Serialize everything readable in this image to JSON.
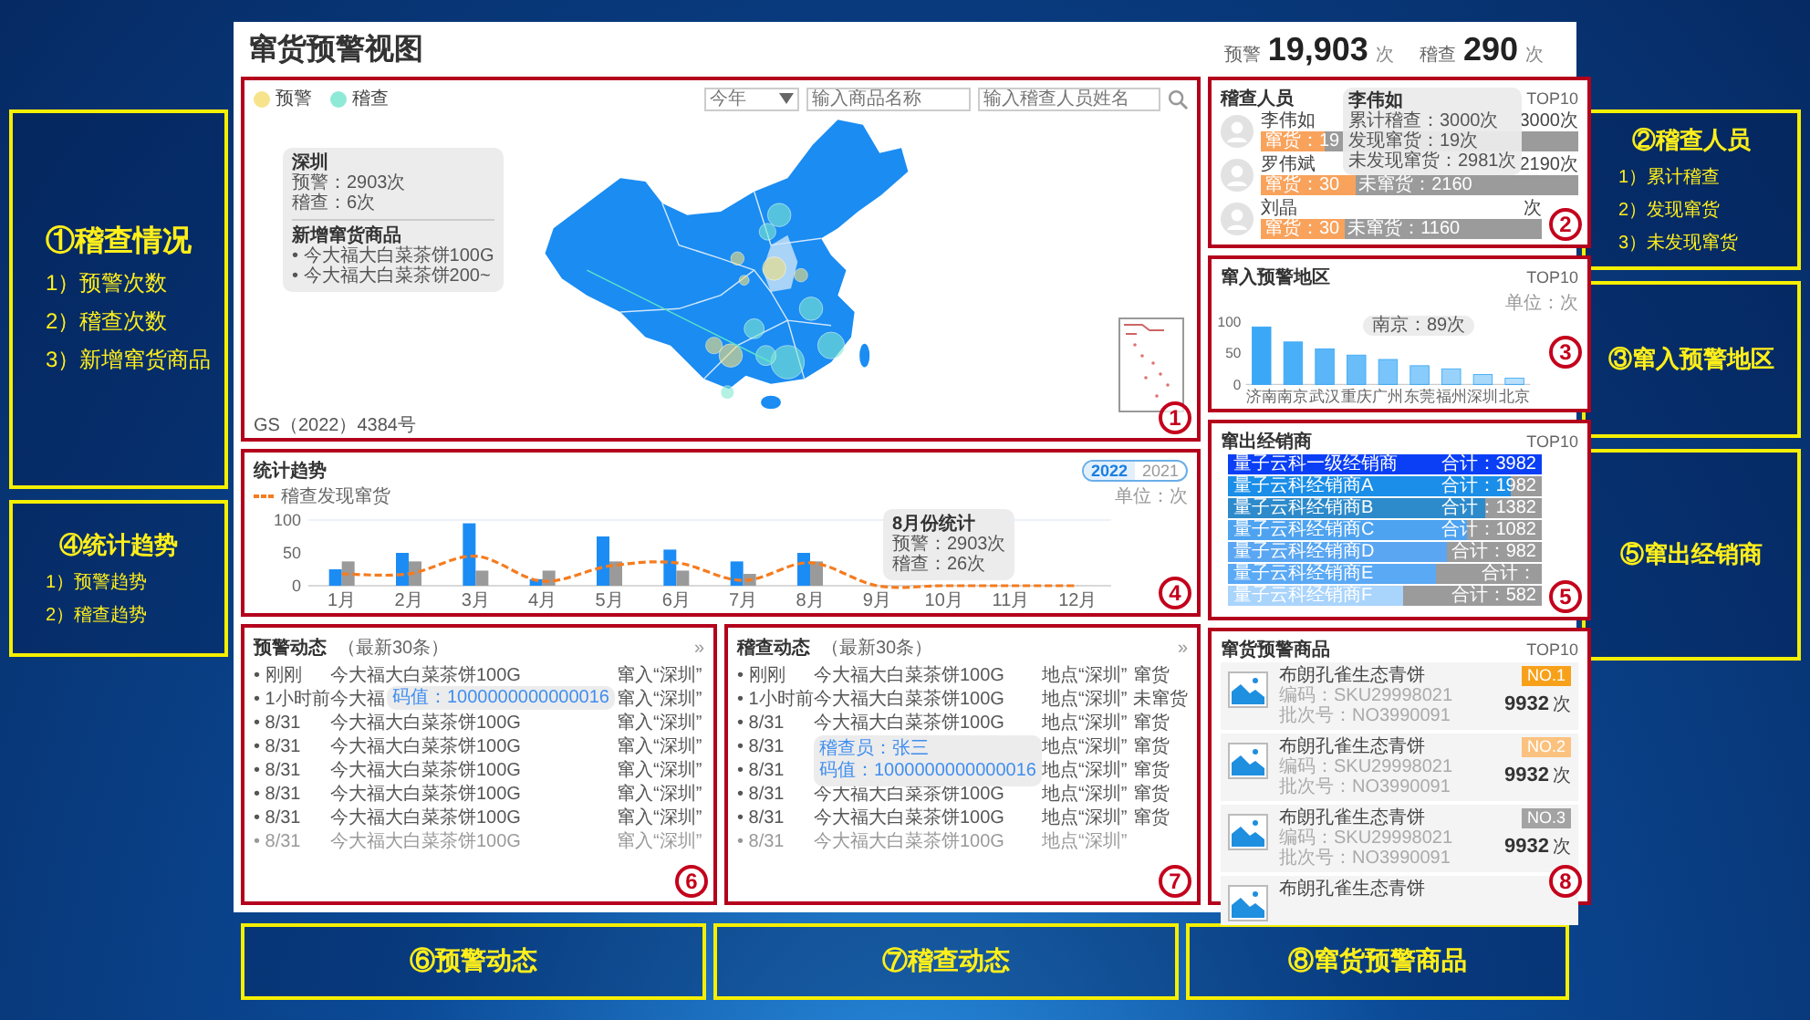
{
  "notes_left": [
    {
      "title": "①稽查情况",
      "items": [
        "1）预警次数",
        "2）稽查次数",
        "3）新增窜货商品"
      ]
    },
    {
      "title": "④统计趋势",
      "items": [
        "1）预警趋势",
        "2）稽查趋势"
      ]
    }
  ],
  "dashboard": {
    "title": "窜货预警视图",
    "totals": [
      {
        "label": "预警",
        "value": "19,903",
        "unit": "次"
      },
      {
        "label": "稽查",
        "value": "290",
        "unit": "次"
      }
    ],
    "map_panel": {
      "marker": "1",
      "legend": [
        {
          "label": "预警",
          "color": "#f6e38c"
        },
        {
          "label": "稽查",
          "color": "#8eead6"
        }
      ],
      "period": "今年",
      "search_fields": [
        {
          "placeholder": "输入商品名称"
        },
        {
          "placeholder": "输入稽查人员姓名"
        }
      ],
      "tooltip": {
        "city": "深圳",
        "lines": [
          "预警：2903次",
          "稽查：6次"
        ],
        "section": "新增窜货商品",
        "items": [
          "• 今大福大白菜茶饼100G",
          "• 今大福大白菜茶饼200~"
        ]
      },
      "footnote": "GS（2022）4384号"
    },
    "trend_panel": {
      "marker": "4",
      "title": "统计趋势",
      "years": [
        {
          "label": "2022",
          "selected": true
        },
        {
          "label": "2021",
          "selected": false
        }
      ],
      "unit": "单位：次",
      "tooltip": {
        "title": "8月份统计",
        "lines": [
          "预警：2903次",
          "稽查：26次"
        ]
      },
      "chart_data": {
        "type": "bar",
        "categories": [
          "1月",
          "2月",
          "3月",
          "4月",
          "5月",
          "6月",
          "7月",
          "8月",
          "9月",
          "10月",
          "11月",
          "12月"
        ],
        "series": [
          {
            "type": "bar",
            "color": "#1c8cf5",
            "values": [
              25,
              50,
              95,
              10,
              75,
              55,
              37,
              50,
              null,
              null,
              null,
              null
            ]
          },
          {
            "type": "bar",
            "color": "#9a9a9a",
            "values": [
              37,
              37,
              23,
              23,
              37,
              23,
              18,
              37,
              null,
              null,
              null,
              null
            ]
          },
          {
            "name": "稽查发现窜货",
            "type": "line",
            "line_style": "dashed",
            "color": "#f57c1f",
            "values": [
              18,
              18,
              45,
              7,
              30,
              35,
              8,
              35,
              0,
              0,
              0,
              0
            ]
          }
        ],
        "ylim": [
          0,
          100
        ],
        "yticks": [
          0,
          50,
          100
        ]
      }
    },
    "warning_feed": {
      "marker": "6",
      "title": "预警动态",
      "subtitle": "（最新30条）",
      "more": "»",
      "rows": [
        {
          "time": "• 刚刚",
          "product": "今大福大白菜茶饼100G",
          "destination": "窜入“深圳”"
        },
        {
          "time": "• 1小时前",
          "product": "今大福",
          "destination": "窜入“深圳”"
        },
        {
          "time": "• 8/31",
          "product": "今大福大白菜茶饼100G",
          "destination": "窜入“深圳”"
        },
        {
          "time": "• 8/31",
          "product": "今大福大白菜茶饼100G",
          "destination": "窜入“深圳”"
        },
        {
          "time": "• 8/31",
          "product": "今大福大白菜茶饼100G",
          "destination": "窜入“深圳”"
        },
        {
          "time": "• 8/31",
          "product": "今大福大白菜茶饼100G",
          "destination": "窜入“深圳”"
        },
        {
          "time": "• 8/31",
          "product": "今大福大白菜茶饼100G",
          "destination": "窜入“深圳”"
        },
        {
          "time": "• 8/31",
          "product": "今大福大白菜茶饼100G",
          "destination": "窜入“深圳”"
        }
      ],
      "tooltip": {
        "lines": [
          "码值：1000000000000016"
        ]
      }
    },
    "inspection_feed": {
      "marker": "7",
      "title": "稽查动态",
      "subtitle": "（最新30条）",
      "more": "»",
      "rows": [
        {
          "time": "• 刚刚",
          "product": "今大福大白菜茶饼100G",
          "place": "地点“深圳”",
          "result": "窜货"
        },
        {
          "time": "• 1小时前",
          "product": "今大福大白菜茶饼100G",
          "place": "地点“深圳”",
          "result": "未窜货"
        },
        {
          "time": "• 8/31",
          "product": "今大福大白菜茶饼100G",
          "place": "地点“深圳”",
          "result": "窜货"
        },
        {
          "time": "• 8/31",
          "place": "地点“深圳”",
          "result": "窜货"
        },
        {
          "time": "• 8/31",
          "place": "地点“深圳”",
          "result": "窜货"
        },
        {
          "time": "• 8/31",
          "product": "今大福大白菜茶饼100G",
          "place": "地点“深圳”",
          "result": "窜货"
        },
        {
          "time": "• 8/31",
          "product": "今大福大白菜茶饼100G",
          "place": "地点“深圳”",
          "result": "窜货"
        },
        {
          "time": "• 8/31",
          "product": "今大福大白菜茶饼100G",
          "place": "地点“深圳”"
        }
      ],
      "tooltip": {
        "lines": [
          "稽查员：张三",
          "码值：1000000000000016"
        ]
      }
    },
    "inspectors": {
      "marker": "2",
      "title": "稽查人员",
      "badge": "TOP10",
      "people": [
        {
          "name": "李伟如",
          "total": "3000次",
          "found": "窜货：19",
          "level": 0.2
        },
        {
          "name": "罗伟斌",
          "total": "2190次",
          "found": "窜货：30",
          "not_found": "未窜货：2160",
          "level": 0.3
        },
        {
          "name": "刘晶",
          "total": "次",
          "found": "窜货：30",
          "not_found": "未窜货：1160",
          "level": 0.3
        }
      ],
      "tooltip": {
        "name": "李伟如",
        "lines": [
          "累计稽查：3000次",
          "发现窜货：19次",
          "未发现窜货：2981次"
        ]
      }
    },
    "regions": {
      "marker": "3",
      "title": "窜入预警地区",
      "badge": "TOP10",
      "unit": "单位：次",
      "tooltip": "南京：89次",
      "chart_data": {
        "type": "bar",
        "categories": [
          "济南",
          "南京",
          "武汉",
          "重庆",
          "广州",
          "东莞",
          "福州",
          "深圳",
          "北京"
        ],
        "series": [
          {
            "color": "#3aa8f7",
            "values": [
              92,
              68,
              57,
              47,
              40,
              30,
              25,
              16,
              10
            ]
          }
        ],
        "ylim": [
          0,
          100
        ],
        "yticks": [
          0,
          50,
          100
        ]
      }
    },
    "dealers": {
      "marker": "5",
      "title": "窜出经销商",
      "badge": "TOP10",
      "rows": [
        {
          "name": "量子云科一级经销商",
          "total": "合计：3982",
          "level": 1,
          "color": "#0b3ff5"
        },
        {
          "name": "量子云科经销商A",
          "total": "合计：1982",
          "level": 0.9,
          "color": "#1a8ee8"
        },
        {
          "name": "量子云科经销商B",
          "total": "合计：1382",
          "level": 0.82,
          "color": "#2d8acb"
        },
        {
          "name": "量子云科经销商C",
          "total": "合计：1082",
          "level": 0.76,
          "color": "#4ea3f0"
        },
        {
          "name": "量子云科经销商D",
          "total": "合计：982",
          "level": 0.7,
          "color": "#5aa6f2"
        },
        {
          "name": "量子云科经销商E",
          "total": "合计：",
          "level": 0.66,
          "color": "#5aa9f5"
        },
        {
          "name": "量子云科经销商F",
          "total": "合计：582",
          "level": 0.56,
          "color": "#a9d4fc"
        }
      ]
    },
    "products": {
      "marker": "8",
      "title": "窜货预警商品",
      "badge": "TOP10",
      "items": [
        {
          "name": "布朗孔雀生态青饼",
          "code": "编码：SKU29998021",
          "batch": "批次号：NO3990091",
          "rank": "NO.1",
          "color": "#f7a11a",
          "count": "9932",
          "unit": "次"
        },
        {
          "name": "布朗孔雀生态青饼",
          "code": "编码：SKU29998021",
          "batch": "批次号：NO3990091",
          "rank": "NO.2",
          "color": "#fbc27f",
          "count": "9932",
          "unit": "次"
        },
        {
          "name": "布朗孔雀生态青饼",
          "code": "编码：SKU29998021",
          "batch": "批次号：NO3990091",
          "rank": "NO.3",
          "color": "#a3a3a3",
          "count": "9932",
          "unit": "次"
        },
        {
          "name": "布朗孔雀生态青饼"
        }
      ]
    }
  },
  "notes_right": [
    {
      "title": "②稽查人员",
      "items": [
        "1）累计稽查",
        "2）发现窜货",
        "3）未发现窜货"
      ]
    },
    {
      "title": "③窜入预警地区"
    },
    {
      "title": "⑤窜出经销商"
    }
  ],
  "notes_bottom": [
    "⑥预警动态",
    "⑦稽查动态",
    "⑧窜货预警商品"
  ]
}
